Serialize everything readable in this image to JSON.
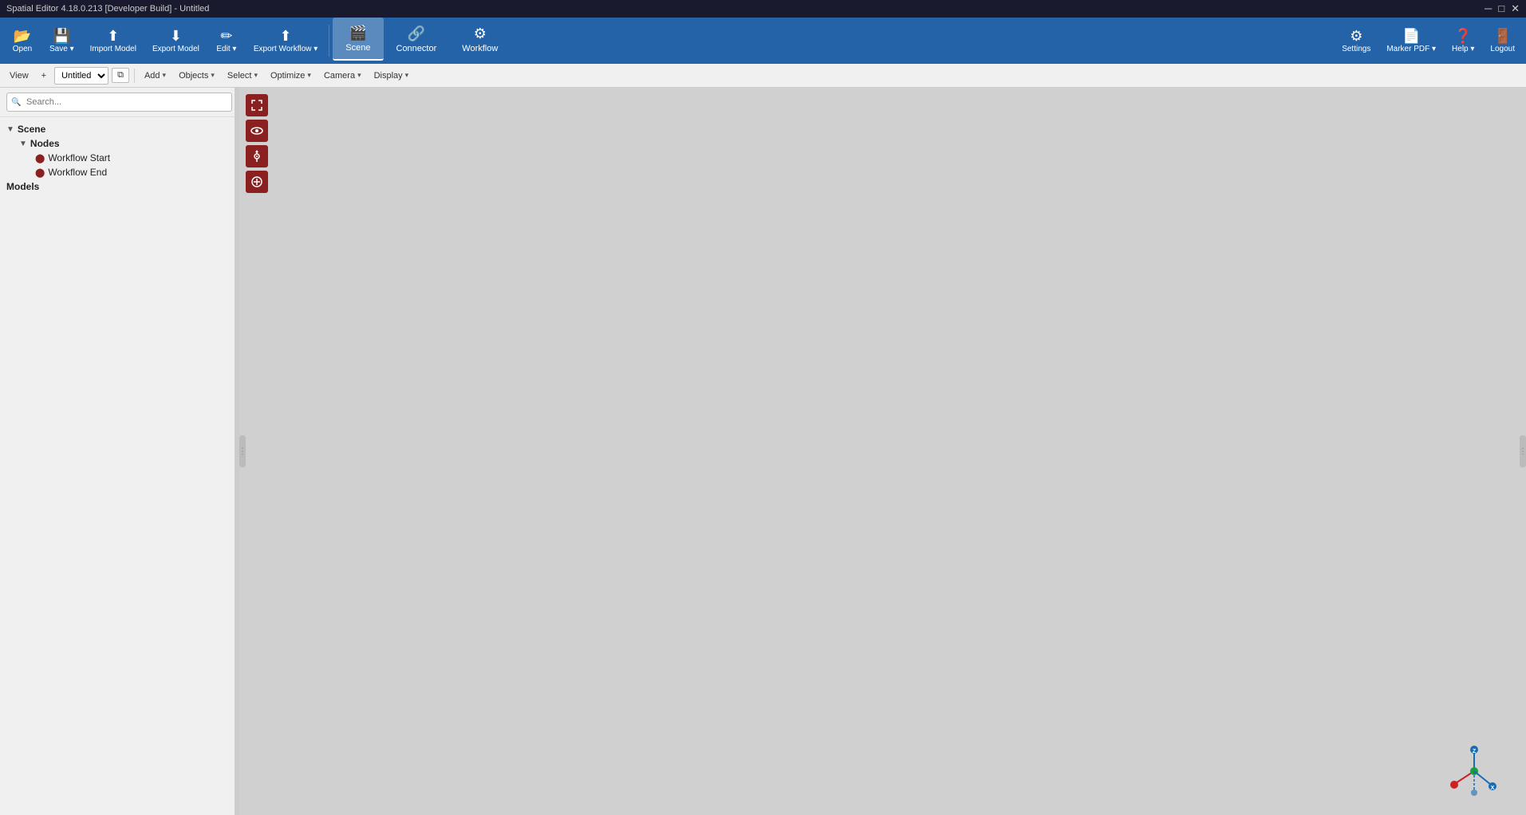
{
  "titleBar": {
    "title": "Spatial Editor 4.18.0.213 [Developer Build] - Untitled",
    "controls": [
      "─",
      "□",
      "✕"
    ]
  },
  "mainToolbar": {
    "buttons": [
      {
        "id": "open",
        "icon": "📂",
        "label": "Open"
      },
      {
        "id": "save",
        "icon": "💾",
        "label": "Save",
        "hasDropdown": true
      },
      {
        "id": "import-model",
        "icon": "⬆",
        "label": "Import Model"
      },
      {
        "id": "export-model",
        "icon": "⬇",
        "label": "Export Model"
      },
      {
        "id": "edit",
        "icon": "✏",
        "label": "Edit",
        "hasDropdown": true
      },
      {
        "id": "export-workflow",
        "icon": "⬆",
        "label": "Export Workflow",
        "hasDropdown": true
      }
    ],
    "viewTabs": [
      {
        "id": "scene",
        "icon": "🎬",
        "label": "Scene",
        "active": true
      },
      {
        "id": "connector",
        "icon": "🔗",
        "label": "Connector",
        "active": false
      },
      {
        "id": "workflow",
        "icon": "⚙",
        "label": "Workflow",
        "active": false
      }
    ],
    "rightButtons": [
      {
        "id": "settings",
        "icon": "⚙",
        "label": "Settings"
      },
      {
        "id": "marker-pdf",
        "icon": "📄",
        "label": "Marker PDF",
        "hasDropdown": true
      },
      {
        "id": "help",
        "icon": "❓",
        "label": "Help",
        "hasDropdown": true
      },
      {
        "id": "logout",
        "icon": "🚪",
        "label": "Logout"
      }
    ]
  },
  "secondaryToolbar": {
    "viewLabel": "View",
    "addLabel": "+",
    "viewNameOptions": [
      "Untitled"
    ],
    "viewNameSelected": "Untitled",
    "copyButton": "⧉",
    "menuItems": [
      {
        "id": "add",
        "label": "Add",
        "hasDropdown": true
      },
      {
        "id": "objects",
        "label": "Objects",
        "hasDropdown": true
      },
      {
        "id": "select",
        "label": "Select",
        "hasDropdown": true
      },
      {
        "id": "optimize",
        "label": "Optimize",
        "hasDropdown": true
      },
      {
        "id": "camera",
        "label": "Camera",
        "hasDropdown": true
      },
      {
        "id": "display",
        "label": "Display",
        "hasDropdown": true
      }
    ]
  },
  "leftPanel": {
    "searchPlaceholder": "Search...",
    "tree": {
      "scene": {
        "label": "Scene",
        "expanded": true,
        "children": {
          "nodes": {
            "label": "Nodes",
            "expanded": true,
            "children": [
              {
                "label": "Workflow Start",
                "icon": "○"
              },
              {
                "label": "Workflow End",
                "icon": "○"
              }
            ]
          }
        }
      },
      "models": {
        "label": "Models"
      }
    }
  },
  "viewport": {
    "background": "#d0d0d0",
    "axisIndicator": {
      "zLabel": "Z",
      "xLabel": "X",
      "zColor": "#1a6bb5",
      "xColor": "#cc2222",
      "originColor": "#1a9e3a"
    }
  },
  "colors": {
    "toolbarBg": "#2563a8",
    "panelBg": "#f0f0f0",
    "activeTab": "rgba(255,255,255,0.25)",
    "viewportBg": "#d0d0d0",
    "vpBtnBg": "#8b2020"
  }
}
